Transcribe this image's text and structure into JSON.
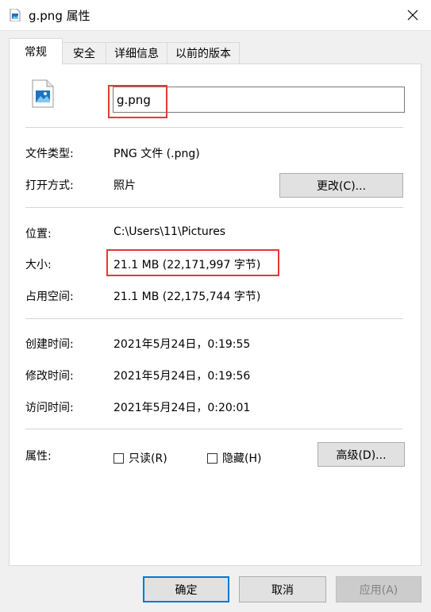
{
  "window": {
    "title": "g.png 属性",
    "close_icon": "close-icon"
  },
  "tabs": [
    {
      "label": "常规",
      "active": true
    },
    {
      "label": "安全"
    },
    {
      "label": "详细信息"
    },
    {
      "label": "以前的版本"
    }
  ],
  "file": {
    "name": "g.png",
    "icon": "image-file-icon"
  },
  "props": {
    "type": {
      "label": "文件类型:",
      "value": "PNG 文件 (.png)"
    },
    "opens": {
      "label": "打开方式:",
      "value": "照片",
      "button": "更改(C)..."
    },
    "location": {
      "label": "位置:",
      "value": "C:\\Users\\11\\Pictures"
    },
    "size": {
      "label": "大小:",
      "value": "21.1 MB (22,171,997 字节)"
    },
    "disk": {
      "label": "占用空间:",
      "value": "21.1 MB (22,175,744 字节)"
    },
    "created": {
      "label": "创建时间:",
      "value": "2021年5月24日，0:19:55"
    },
    "modified": {
      "label": "修改时间:",
      "value": "2021年5月24日，0:19:56"
    },
    "accessed": {
      "label": "访问时间:",
      "value": "2021年5月24日，0:20:01"
    },
    "attributes": {
      "label": "属性:",
      "readonly": {
        "label": "只读(R)",
        "checked": false
      },
      "hidden": {
        "label": "隐藏(H)",
        "checked": false
      },
      "advanced": "高级(D)..."
    }
  },
  "footer": {
    "ok": "确定",
    "cancel": "取消",
    "apply": "应用(A)"
  },
  "colors": {
    "highlight": "#e53935",
    "accent": "#0078d7"
  }
}
